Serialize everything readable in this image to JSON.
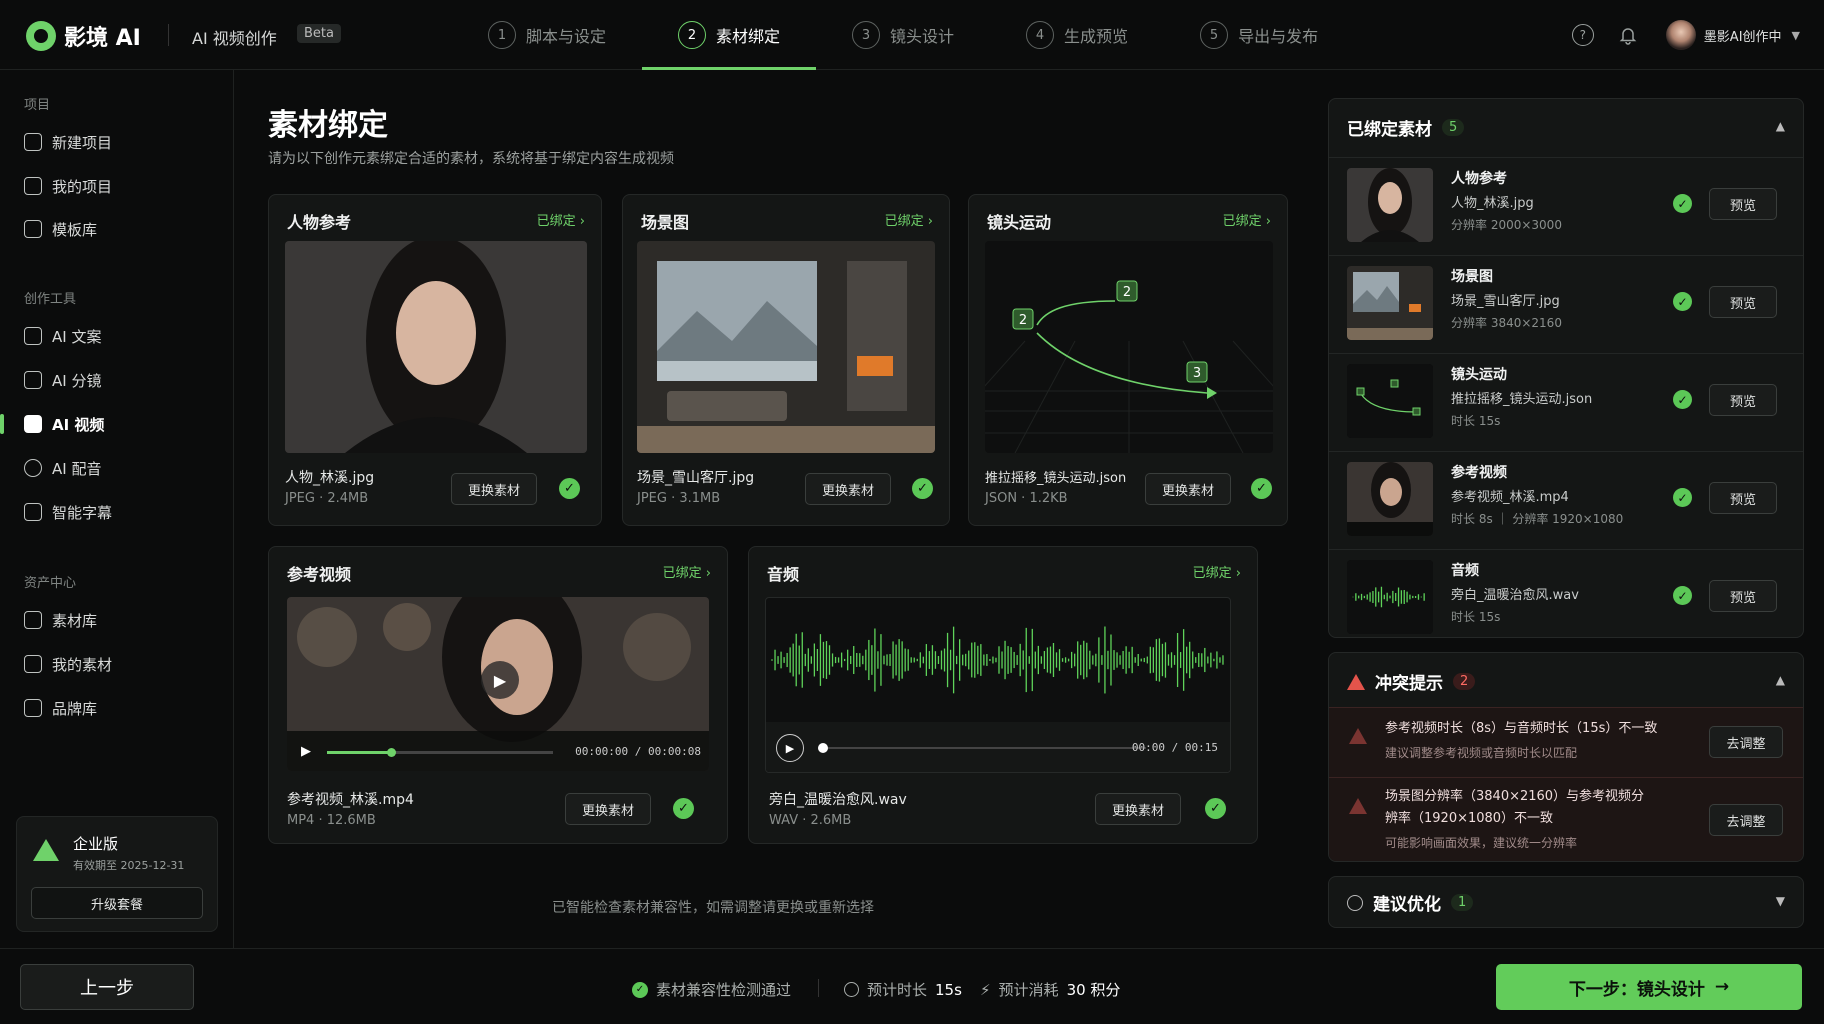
{
  "app": {
    "logo": "影境 AI",
    "title": "AI 视频创作",
    "beta": "Beta"
  },
  "steps": [
    {
      "num": "1",
      "label": "脚本与设定"
    },
    {
      "num": "2",
      "label": "素材绑定"
    },
    {
      "num": "3",
      "label": "镜头设计"
    },
    {
      "num": "4",
      "label": "生成预览"
    },
    {
      "num": "5",
      "label": "导出与发布"
    }
  ],
  "user": {
    "name": "墨影AI创作中"
  },
  "sidebar": {
    "section_project": "项目",
    "project_items": [
      "新建项目",
      "我的项目",
      "模板库"
    ],
    "section_tools": "创作工具",
    "tool_items": [
      "AI 文案",
      "AI 分镜",
      "AI 视频",
      "AI 配音",
      "智能字幕"
    ],
    "section_assets": "资产中心",
    "asset_items": [
      "素材库",
      "我的素材",
      "品牌库"
    ],
    "plan": {
      "name": "企业版",
      "expiry": "有效期至 2025-12-31",
      "upgrade": "升级套餐"
    }
  },
  "main": {
    "title": "素材绑定",
    "subtitle": "请为以下创作元素绑定合适的素材，系统将基于绑定内容生成视频",
    "bound_label": "已绑定",
    "swap_label": "更换素材",
    "cards": [
      {
        "title": "人物参考",
        "file": "人物_林溪.jpg",
        "meta": "JPEG · 2.4MB"
      },
      {
        "title": "场景图",
        "file": "场景_雪山客厅.jpg",
        "meta": "JPEG · 3.1MB"
      },
      {
        "title": "镜头运动",
        "file": "推拉摇移_镜头运动.json",
        "meta": "JSON · 1.2KB"
      },
      {
        "title": "参考视频",
        "file": "参考视频_林溪.mp4",
        "meta": "MP4 · 12.6MB",
        "time": "00:00:00 / 00:00:08"
      },
      {
        "title": "音频",
        "file": "旁白_温暖治愈风.wav",
        "meta": "WAV · 2.6MB",
        "time": "00:00 / 00:15"
      }
    ],
    "camera_points": [
      "2",
      "2",
      "3"
    ],
    "hint": "已智能检查素材兼容性，如需调整请更换或重新选择"
  },
  "bound_panel": {
    "title": "已绑定素材",
    "count": "5",
    "preview_label": "预览",
    "items": [
      {
        "type": "人物参考",
        "file": "人物_林溪.jpg",
        "meta": "分辨率 2000×3000"
      },
      {
        "type": "场景图",
        "file": "场景_雪山客厅.jpg",
        "meta": "分辨率 3840×2160"
      },
      {
        "type": "镜头运动",
        "file": "推拉摇移_镜头运动.json",
        "meta": "时长 15s"
      },
      {
        "type": "参考视频",
        "file": "参考视频_林溪.mp4",
        "meta": "时长 8s ｜ 分辨率 1920×1080"
      },
      {
        "type": "音频",
        "file": "旁白_温暖治愈风.wav",
        "meta": "时长 15s"
      }
    ]
  },
  "conflict_panel": {
    "title": "冲突提示",
    "count": "2",
    "adjust_label": "去调整",
    "items": [
      {
        "line1": "参考视频时长（8s）与音频时长（15s）不一致",
        "line2": "",
        "sub": "建议调整参考视频或音频时长以匹配"
      },
      {
        "line1": "场景图分辨率（3840×2160）与参考视频分",
        "line2": "辨率（1920×1080）不一致",
        "sub": "可能影响画面效果，建议统一分辨率"
      }
    ]
  },
  "suggest_panel": {
    "title": "建议优化",
    "count": "1"
  },
  "footer": {
    "prev": "上一步",
    "compat": "素材兼容性检测通过",
    "duration_label": "预计时长",
    "duration": "15s",
    "cost_label": "预计消耗",
    "cost": "30 积分",
    "next": "下一步：镜头设计"
  },
  "colors": {
    "accent": "#6fd26a",
    "danger": "#e4544b",
    "bg": "#0b0c0c"
  }
}
